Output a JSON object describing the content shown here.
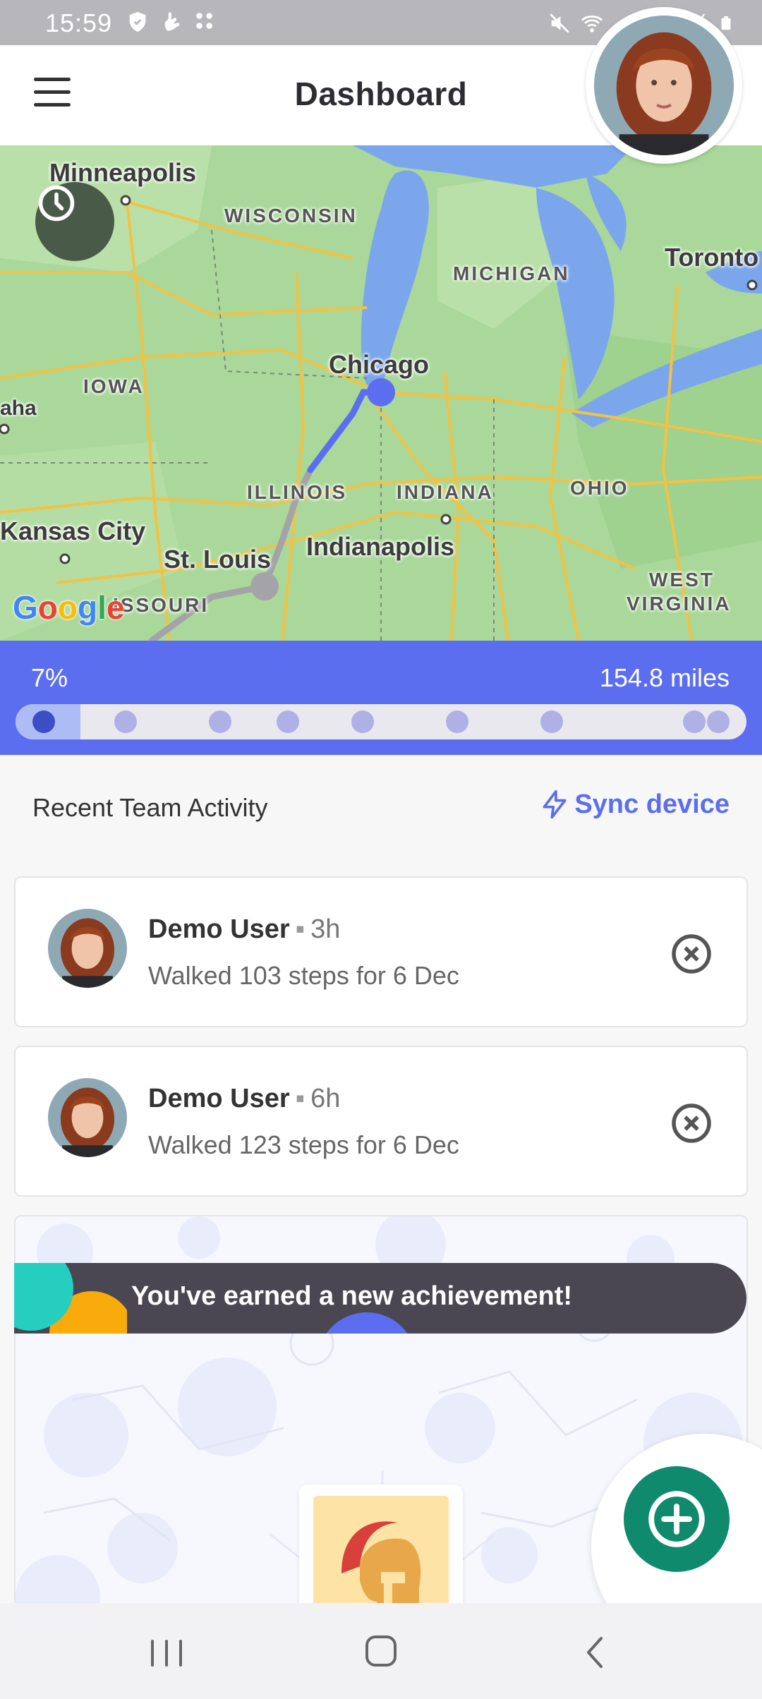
{
  "status_bar": {
    "time": "15:59",
    "battery": "100%"
  },
  "header": {
    "title": "Dashboard"
  },
  "map": {
    "cities": [
      "Minneapolis",
      "Toronto",
      "Chicago",
      "Kansas City",
      "St. Louis",
      "Indianapolis",
      "aha"
    ],
    "states": [
      "WISCONSIN",
      "MICHIGAN",
      "IOWA",
      "ILLINOIS",
      "INDIANA",
      "OHIO",
      "WEST",
      "VIRGINIA",
      "ISSOURI"
    ],
    "attribution": "Google"
  },
  "progress": {
    "percent_label": "7%",
    "distance_label": "154.8 miles",
    "fraction": 0.07
  },
  "activity": {
    "title": "Recent Team Activity",
    "sync_label": "Sync device",
    "items": [
      {
        "name": "Demo User",
        "separator": "▪",
        "time": "3h",
        "description": "Walked 103 steps for 6 Dec"
      },
      {
        "name": "Demo User",
        "separator": "▪",
        "time": "6h",
        "description": "Walked 123 steps for 6 Dec"
      }
    ]
  },
  "achievement": {
    "message": "You've earned a new achievement!"
  },
  "colors": {
    "accent": "#5b6ef0",
    "fab": "#0f8a6c",
    "banner": "#4a4752"
  }
}
